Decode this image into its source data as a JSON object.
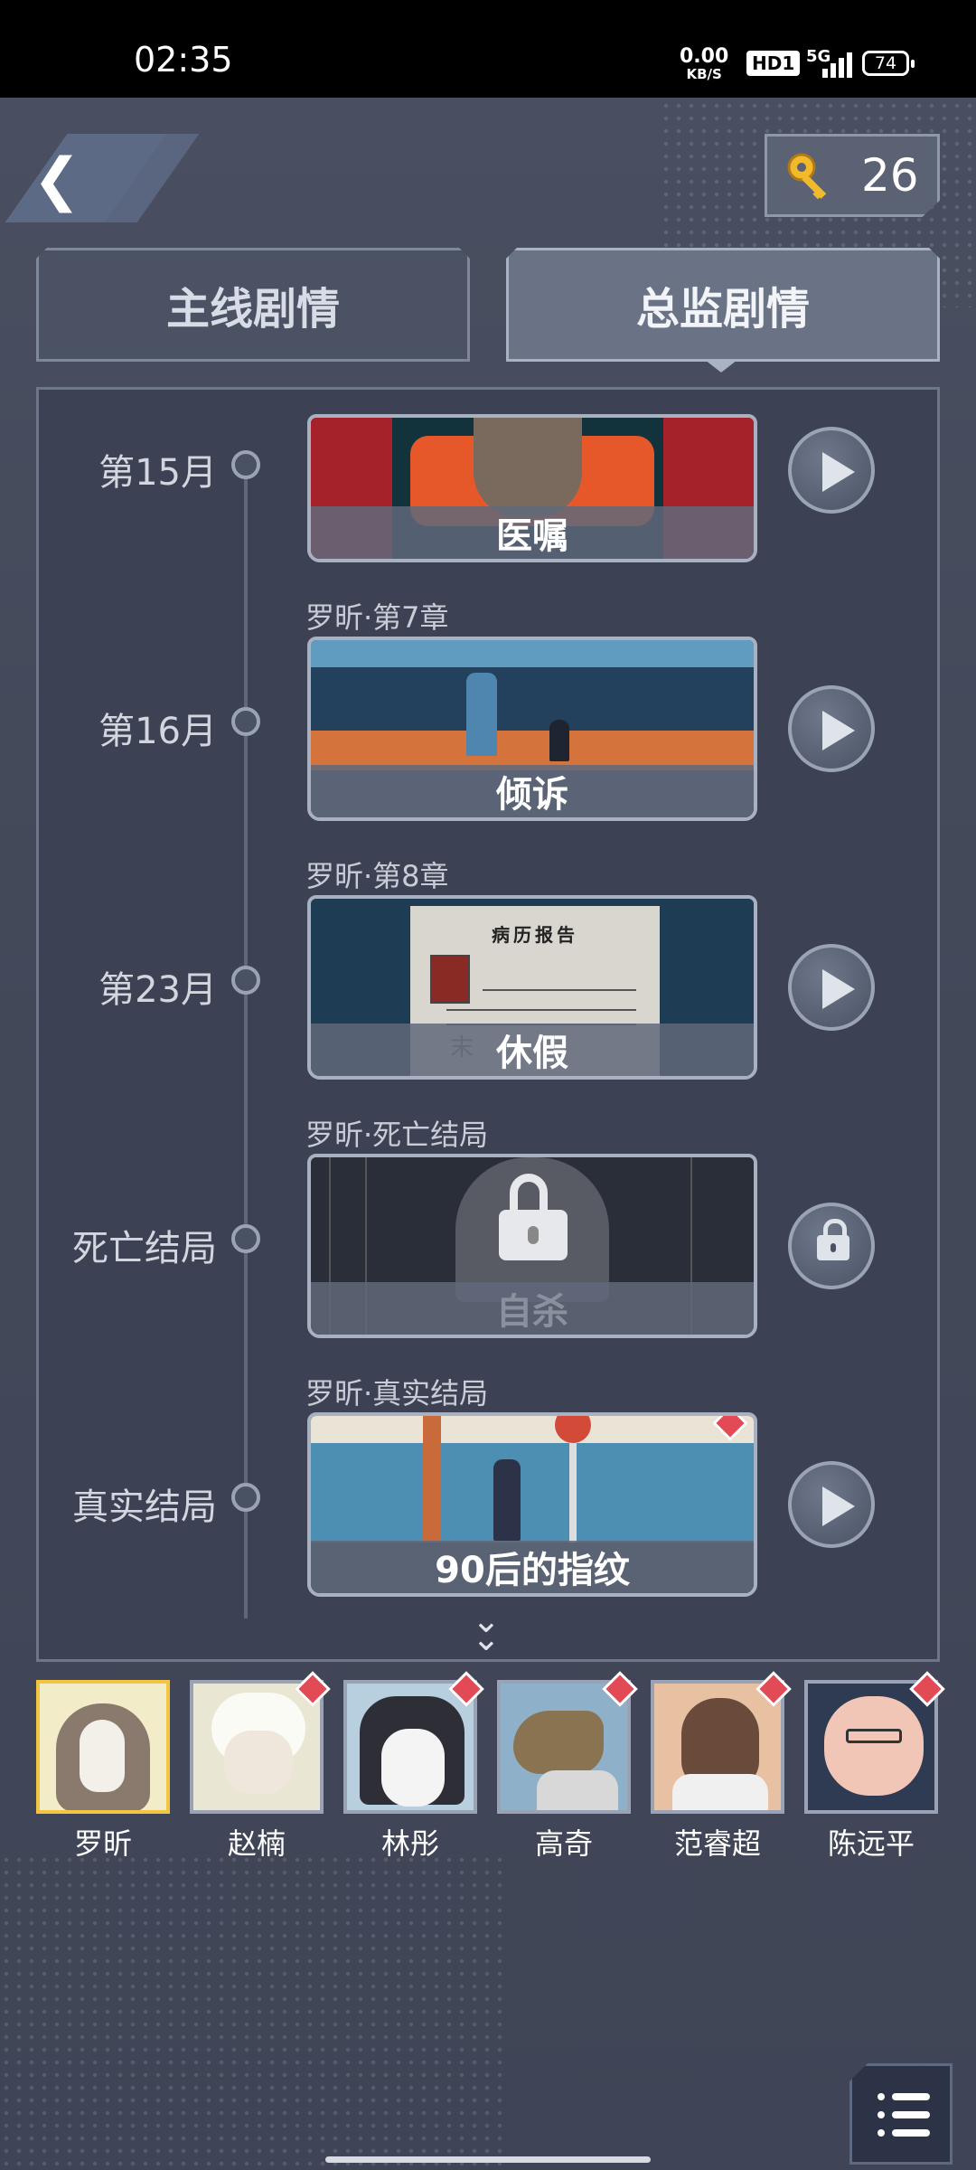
{
  "status_bar": {
    "time": "02:35",
    "net_speed": "0.00",
    "net_unit": "KB/S",
    "hd": "HD1",
    "network": "5G",
    "battery": "74"
  },
  "header": {
    "back_icon": "chevron-left-icon",
    "key_icon": "key-icon",
    "key_count": "26"
  },
  "tabs": [
    {
      "label": "主线剧情",
      "active": false
    },
    {
      "label": "总监剧情",
      "active": true
    }
  ],
  "timeline": [
    {
      "label": "第15月",
      "subtitle": "",
      "title": "医嘱",
      "locked": false,
      "new": false,
      "action": "play-icon"
    },
    {
      "label": "第16月",
      "subtitle": "罗昕·第7章",
      "title": "倾诉",
      "locked": false,
      "new": false,
      "action": "play-icon"
    },
    {
      "label": "第23月",
      "subtitle": "罗昕·第8章",
      "title": "休假",
      "locked": false,
      "new": false,
      "action": "play-icon",
      "doc_title": "病历报告",
      "doc_text": "末"
    },
    {
      "label": "死亡结局",
      "subtitle": "罗昕·死亡结局",
      "title": "自杀",
      "locked": true,
      "new": false,
      "action": "lock-icon"
    },
    {
      "label": "真实结局",
      "subtitle": "罗昕·真实结局",
      "title": "90后的指纹",
      "locked": false,
      "new": true,
      "action": "play-icon"
    }
  ],
  "characters": [
    {
      "name": "罗昕",
      "selected": true,
      "new": false
    },
    {
      "name": "赵楠",
      "selected": false,
      "new": true
    },
    {
      "name": "林彤",
      "selected": false,
      "new": true
    },
    {
      "name": "高奇",
      "selected": false,
      "new": true
    },
    {
      "name": "范睿超",
      "selected": false,
      "new": true
    },
    {
      "name": "陈远平",
      "selected": false,
      "new": true
    }
  ],
  "colors": {
    "background": "#434959",
    "accent_selected": "#f4c542",
    "new_badge": "#e24a55"
  },
  "menu_icon": "list-menu-icon"
}
